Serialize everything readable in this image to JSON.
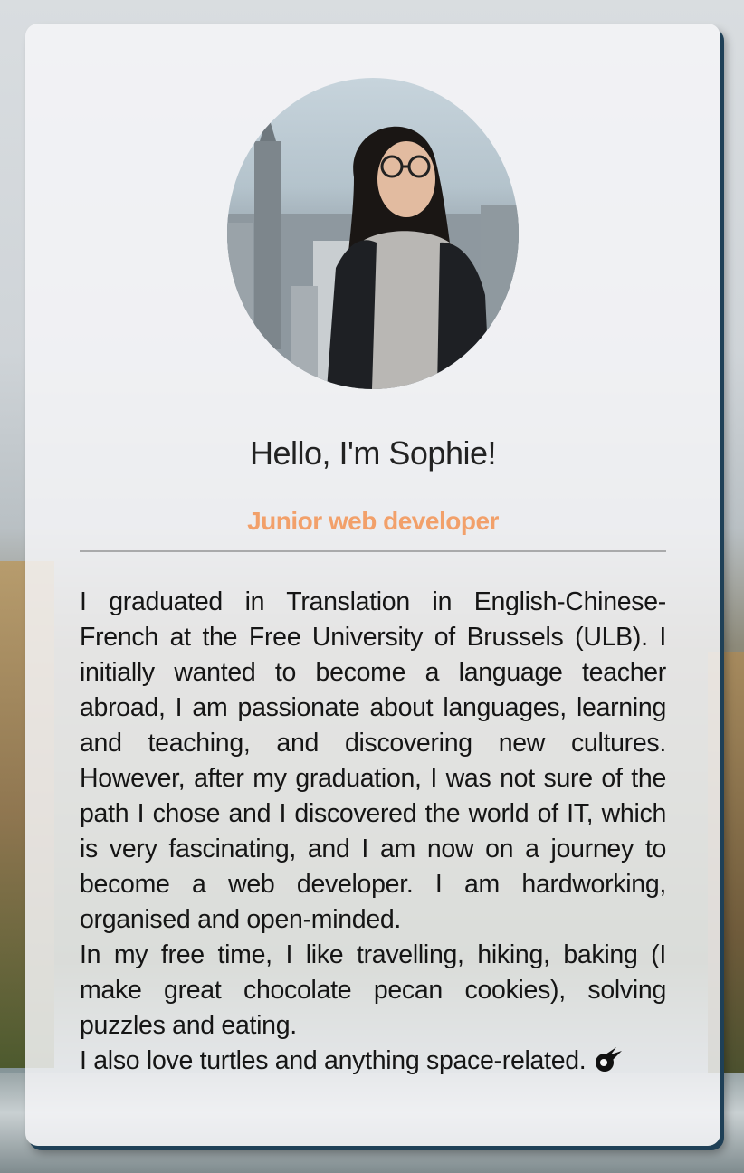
{
  "profile": {
    "photo_alt": "Portrait photo",
    "greeting": "Hello, I'm Sophie!",
    "role": "Junior web developer",
    "bio": {
      "paragraph_1": "I graduated in Translation in English-Chinese-French at the Free University of Brussels (ULB). I initially wanted to become a language teacher abroad, I am passionate about languages, learning and teaching, and discovering new cultures. However, after my graduation, I was not sure of the path I chose and I discovered the world of IT, which is very fascinating, and I am now on a journey to become a web developer. I am hardworking, organised and open-minded.",
      "paragraph_2": "In my free time, I like travelling, hiking, baking (I make great chocolate pecan cookies), solving puzzles and eating.",
      "paragraph_3": "I also love turtles and anything space-related."
    },
    "trailing_icon": "meteor-icon"
  },
  "colors": {
    "accent": "#f2a06a",
    "card_shadow": "#1f4057",
    "text": "#151515"
  }
}
